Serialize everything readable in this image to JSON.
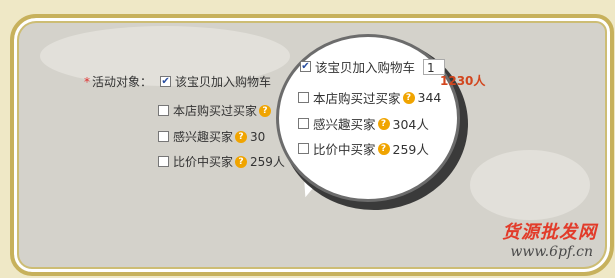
{
  "form": {
    "label_required": "*",
    "label": "活动对象：",
    "options": [
      {
        "label": "该宝贝加入购物车",
        "checked": true,
        "count": ""
      },
      {
        "label": "本店购买过买家",
        "checked": false,
        "count": ""
      },
      {
        "label": "感兴趣买家",
        "checked": false,
        "count": "30"
      },
      {
        "label": "比价中买家",
        "checked": false,
        "count": "259人"
      }
    ]
  },
  "magnifier": {
    "options": [
      {
        "label": "该宝贝加入购物车",
        "checked": true,
        "input_value": "1",
        "count": "1230人"
      },
      {
        "label": "本店购买过买家",
        "checked": false,
        "count": "344"
      },
      {
        "label": "感兴趣买家",
        "checked": false,
        "count": "304人"
      },
      {
        "label": "比价中买家",
        "checked": false,
        "count": "259人"
      }
    ]
  },
  "watermark": {
    "brand": "货源批发网",
    "url": "www.6pf.cn"
  },
  "colors": {
    "background": "#efe8c6",
    "frame_border": "#c7b15c",
    "panel": "#d4d2cb",
    "count_highlight": "#d2461e",
    "help_icon": "#f0a400"
  }
}
